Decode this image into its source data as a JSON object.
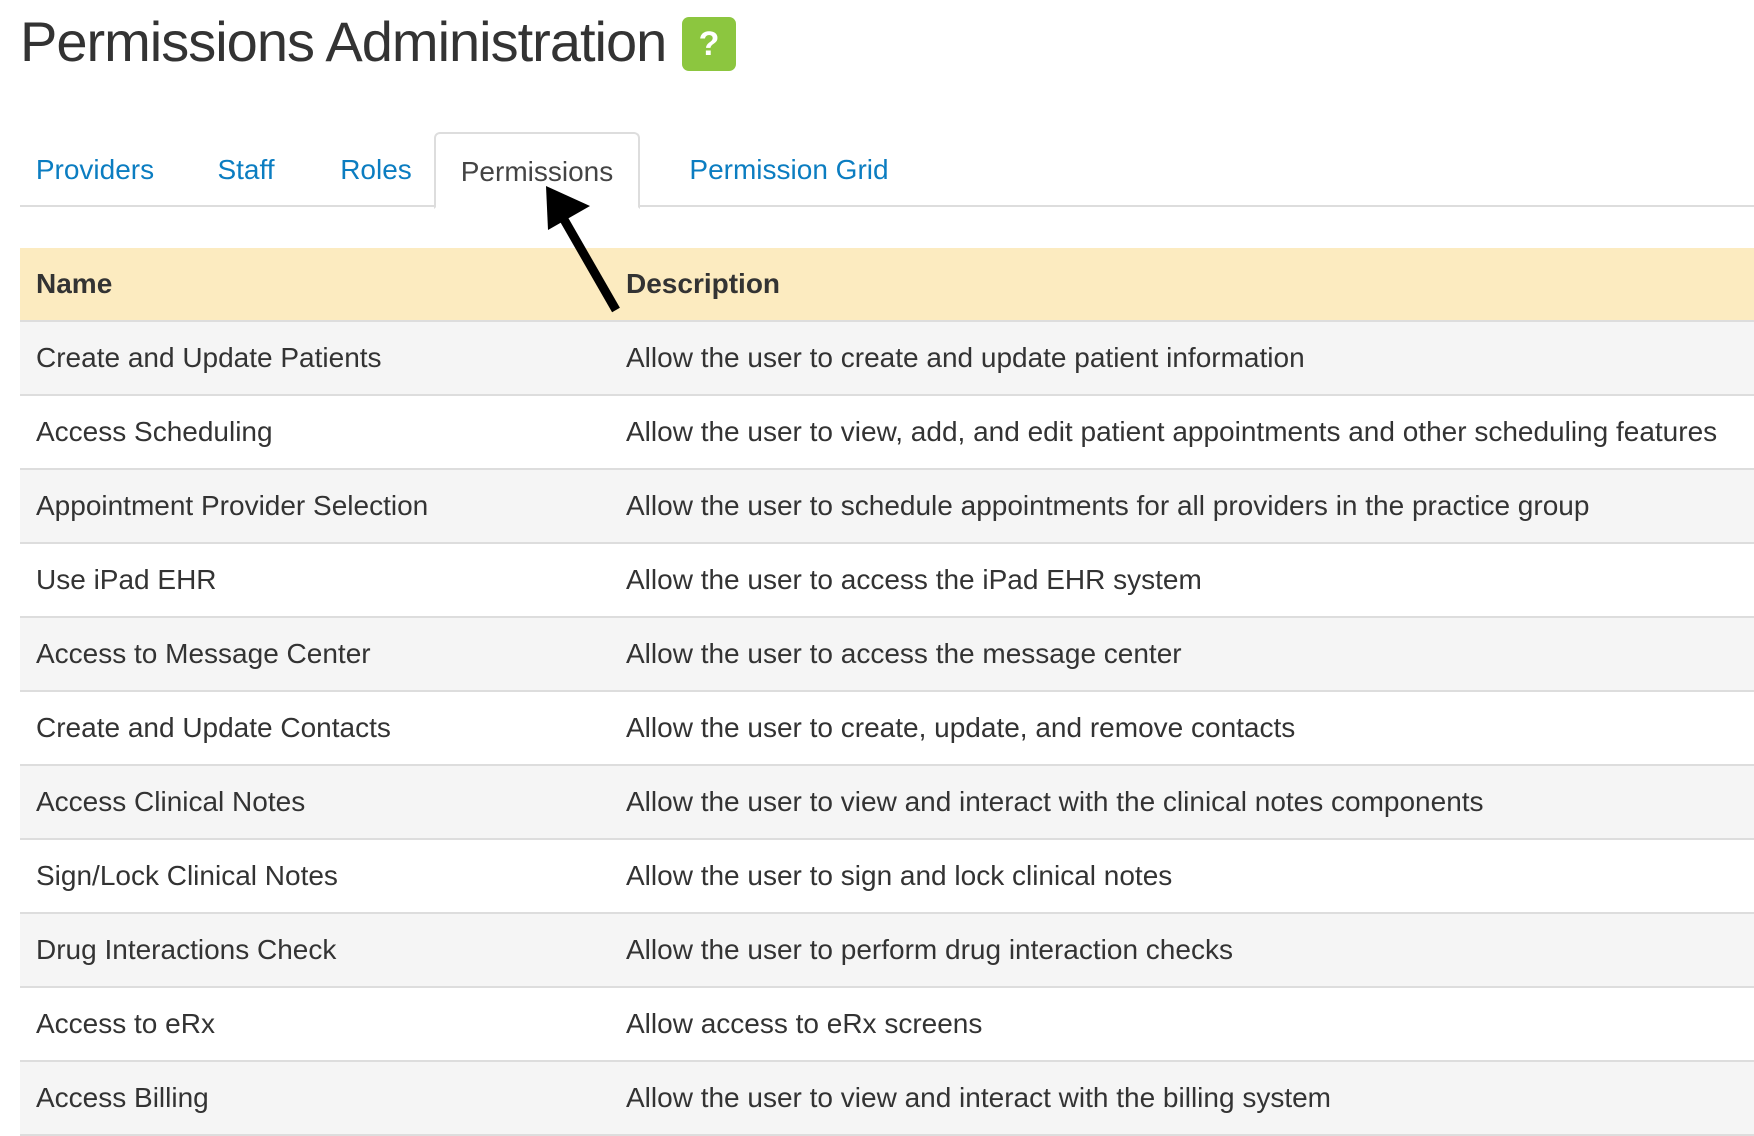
{
  "header": {
    "title": "Permissions Administration",
    "help_label": "?"
  },
  "tabs": [
    {
      "label": "Providers",
      "active": false
    },
    {
      "label": "Staff",
      "active": false
    },
    {
      "label": "Roles",
      "active": false
    },
    {
      "label": "Permissions",
      "active": true
    },
    {
      "label": "Permission Grid",
      "active": false
    }
  ],
  "table": {
    "columns": [
      "Name",
      "Description"
    ],
    "rows": [
      {
        "name": "Create and Update Patients",
        "description": "Allow the user to create and update patient information"
      },
      {
        "name": "Access Scheduling",
        "description": "Allow the user to view, add, and edit patient appointments and other scheduling features"
      },
      {
        "name": "Appointment Provider Selection",
        "description": "Allow the user to schedule appointments for all providers in the practice group"
      },
      {
        "name": "Use iPad EHR",
        "description": "Allow the user to access the iPad EHR system"
      },
      {
        "name": "Access to Message Center",
        "description": "Allow the user to access the message center"
      },
      {
        "name": "Create and Update Contacts",
        "description": "Allow the user to create, update, and remove contacts"
      },
      {
        "name": "Access Clinical Notes",
        "description": "Allow the user to view and interact with the clinical notes components"
      },
      {
        "name": "Sign/Lock Clinical Notes",
        "description": "Allow the user to sign and lock clinical notes"
      },
      {
        "name": "Drug Interactions Check",
        "description": "Allow the user to perform drug interaction checks"
      },
      {
        "name": "Access to eRx",
        "description": "Allow access to eRx screens"
      },
      {
        "name": "Access Billing",
        "description": "Allow the user to view and interact with the billing system"
      }
    ]
  },
  "colors": {
    "link": "#0b7dc1",
    "help_button": "#8cc63f",
    "table_header_bg": "#fcebc0",
    "row_alt_bg": "#f5f5f5",
    "border": "#dddddd"
  },
  "icons": {
    "help": "question-mark-icon",
    "annotation": "arrow-pointer-icon"
  }
}
